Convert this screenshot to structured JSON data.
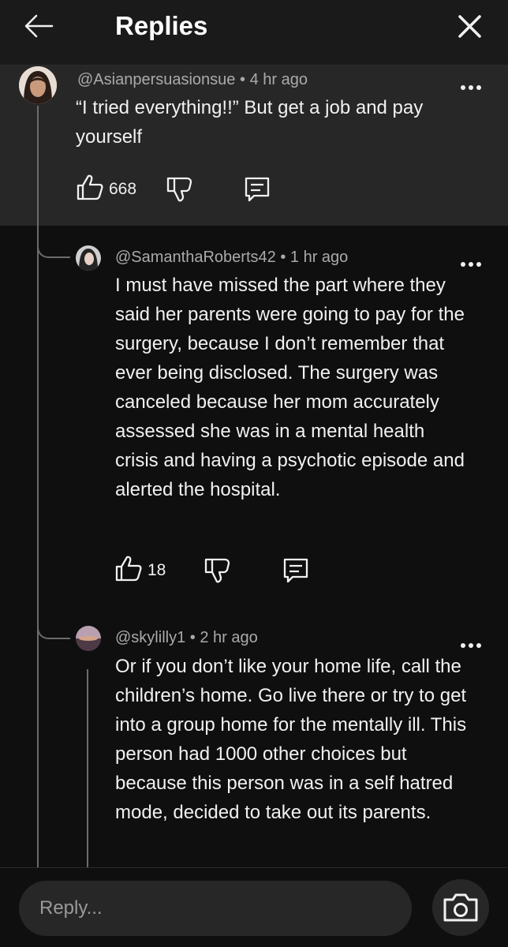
{
  "header": {
    "title": "Replies",
    "back_icon": "arrow-left-icon",
    "close_icon": "close-icon"
  },
  "comments": [
    {
      "handle": "@Asianpersuasionsue",
      "time": "4 hr ago",
      "text": "“I tried everything!!” But get a job and pay yourself",
      "likes": "668"
    },
    {
      "handle": "@SamanthaRoberts42",
      "time": "1 hr ago",
      "text": "I must have missed the part where they said her parents were going to pay for the surgery, because I don’t remember that ever being disclosed. The surgery was canceled because her mom accurately assessed she was in a mental health crisis and having a psychotic episode and alerted the hospital.",
      "likes": "18"
    },
    {
      "handle": "@skylilly1",
      "time": "2 hr ago",
      "text": "Or if you don’t like your home life, call the children’s home. Go live there or try to get into a group home for the mentally ill. This person had 1000 other choices but because this person was in a self hatred mode, decided to take out its parents."
    }
  ],
  "separator": "•",
  "footer": {
    "reply_placeholder": "Reply...",
    "camera_icon": "camera-icon"
  },
  "colors": {
    "background": "#0f0f0f",
    "header": "#1a1a1a",
    "highlight": "#272727",
    "meta_text": "#aaaaaa"
  }
}
